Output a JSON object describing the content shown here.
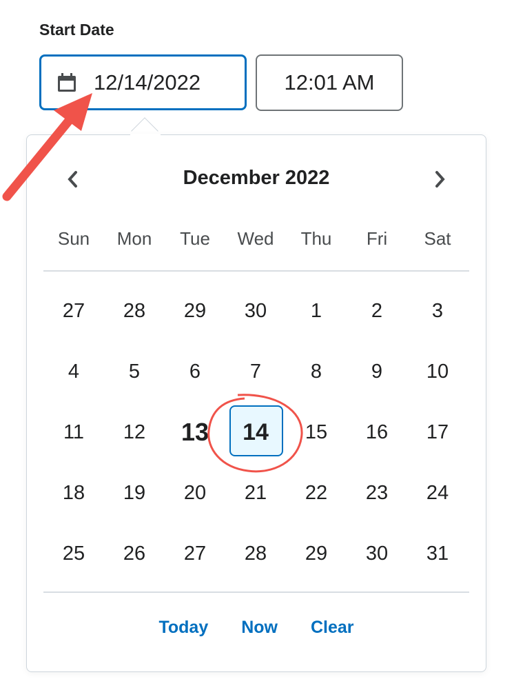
{
  "field": {
    "label": "Start Date",
    "date_value": "12/14/2022",
    "time_value": "12:01 AM",
    "icon": "calendar-icon"
  },
  "calendar": {
    "month_title": "December 2022",
    "weekdays": [
      "Sun",
      "Mon",
      "Tue",
      "Wed",
      "Thu",
      "Fri",
      "Sat"
    ],
    "weeks": [
      [
        "27",
        "28",
        "29",
        "30",
        "1",
        "2",
        "3"
      ],
      [
        "4",
        "5",
        "6",
        "7",
        "8",
        "9",
        "10"
      ],
      [
        "11",
        "12",
        "13",
        "14",
        "15",
        "16",
        "17"
      ],
      [
        "18",
        "19",
        "20",
        "21",
        "22",
        "23",
        "24"
      ],
      [
        "25",
        "26",
        "27",
        "28",
        "29",
        "30",
        "31"
      ]
    ],
    "today": "13",
    "selected": "14",
    "footer": {
      "today": "Today",
      "now": "Now",
      "clear": "Clear"
    }
  },
  "colors": {
    "accent": "#006fbf",
    "selected_bg": "#e8f8ff",
    "annotation": "#f0534a"
  }
}
